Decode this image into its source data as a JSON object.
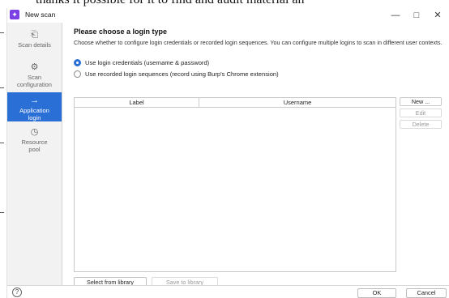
{
  "document_fragment": "thanks it possible for it to find and audit material an",
  "window": {
    "title": "New scan",
    "logo_glyph": "✦",
    "minimize_glyph": "—",
    "maximize_glyph": "□",
    "close_glyph": "✕"
  },
  "sidebar": {
    "items": [
      {
        "label": "Scan details",
        "icon": "send-icon",
        "glyph": "⎗",
        "active": false
      },
      {
        "label": "Scan configuration",
        "icon": "gear-icon",
        "glyph": "⚙",
        "active": false
      },
      {
        "label": "Application login",
        "icon": "login-arrow-icon",
        "glyph": "→",
        "active": true
      },
      {
        "label": "Resource pool",
        "icon": "clock-icon",
        "glyph": "◷",
        "active": false
      }
    ]
  },
  "main": {
    "heading": "Please choose a login type",
    "description": "Choose whether to configure login credentials or recorded login sequences. You can configure multiple logins to scan in different user contexts.",
    "radios": [
      {
        "label": "Use login credentials (username & password)",
        "selected": true
      },
      {
        "label": "Use recorded login sequences (record using Burp's Chrome extension)",
        "selected": false
      }
    ],
    "table": {
      "columns": [
        "Label",
        "Username"
      ],
      "rows": []
    },
    "buttons": {
      "new": "New ...",
      "edit": "Edit",
      "delete": "Delete",
      "select_library": "Select from library",
      "save_library": "Save to library"
    }
  },
  "footer": {
    "help_glyph": "?",
    "ok": "OK",
    "cancel": "Cancel"
  },
  "colors": {
    "accent": "#2a6fd6",
    "sidebar_bg": "#f2f2f2",
    "logo": "#7b3fe4"
  }
}
